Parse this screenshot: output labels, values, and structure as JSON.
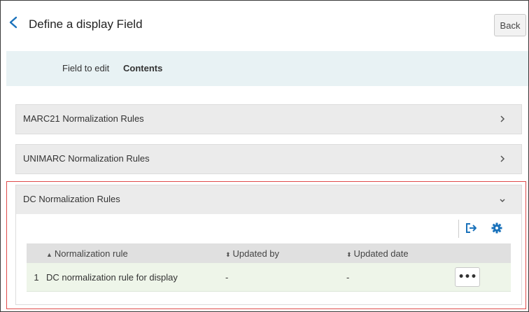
{
  "header": {
    "title": "Define a display Field",
    "back_label": "Back"
  },
  "field": {
    "label": "Field to edit",
    "value": "Contents"
  },
  "sections": [
    {
      "title": "MARC21 Normalization Rules",
      "state": "collapsed"
    },
    {
      "title": "UNIMARC Normalization Rules",
      "state": "collapsed"
    },
    {
      "title": "DC Normalization Rules",
      "state": "expanded"
    }
  ],
  "toolbar": {
    "icons": [
      "export-icon",
      "settings-gear-icon"
    ],
    "accent": "#1a72bb"
  },
  "table": {
    "columns": [
      {
        "label": "Normalization rule",
        "sort": "asc"
      },
      {
        "label": "Updated by",
        "sort": "none"
      },
      {
        "label": "Updated date",
        "sort": "none"
      }
    ],
    "rows": [
      {
        "index": "1",
        "rule": "DC normalization rule for display",
        "updated_by": "-",
        "updated_date": "-",
        "actions_label": "•••"
      }
    ]
  },
  "colors": {
    "highlight_border": "#e04b4b",
    "field_bar": "#e8f2f4",
    "row_background": "#eef5e9"
  }
}
